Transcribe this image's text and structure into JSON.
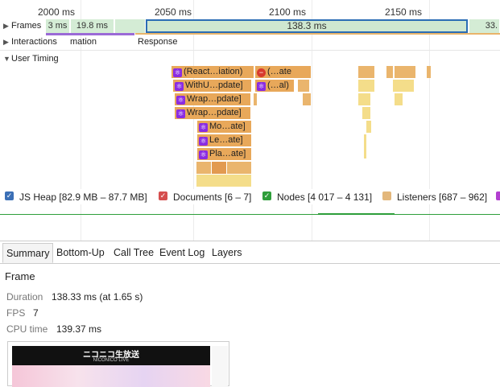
{
  "ruler": {
    "ticks": [
      "2000 ms",
      "2050 ms",
      "2100 ms",
      "2150 ms"
    ]
  },
  "tracks": {
    "frames_label": "Frames",
    "frames": [
      "3 ms",
      "19.8 ms",
      "138.3 ms",
      "33."
    ],
    "interactions_label": "Interactions",
    "interactions_extra": "mation",
    "response_label": "Response",
    "user_timing_label": "User Timing",
    "flame": {
      "row1a": "(React…iation)",
      "row1b": "(…ate",
      "row2a": "WithU…pdate]",
      "row2b": "(…al)",
      "row3": "Wrap…pdate]",
      "row4": "Wrap…pdate]",
      "row5": "Mo…ate]",
      "row6": "Le…ate]",
      "row7": "Pla…ate]"
    }
  },
  "counters": {
    "js_heap": "JS Heap [82.9 MB – 87.7 MB]",
    "documents": "Documents [6 – 7]",
    "nodes": "Nodes [4 017 – 4 131]",
    "listeners": "Listeners [687 – 962]",
    "colors": {
      "js_heap": "#3b6fb6",
      "documents": "#d54e4e",
      "nodes": "#2e9e3a",
      "listeners": "#e3b77b"
    }
  },
  "tabs": [
    "Summary",
    "Bottom-Up",
    "Call Tree",
    "Event Log",
    "Layers"
  ],
  "summary": {
    "title": "Frame",
    "duration_label": "Duration",
    "duration_value": "138.33 ms (at 1.65 s)",
    "fps_label": "FPS",
    "fps_value": "7",
    "cpu_label": "CPU time",
    "cpu_value": "139.37 ms",
    "thumb_logo": "ニコニコ生放送",
    "thumb_sub": "NICONICO LIVE"
  }
}
